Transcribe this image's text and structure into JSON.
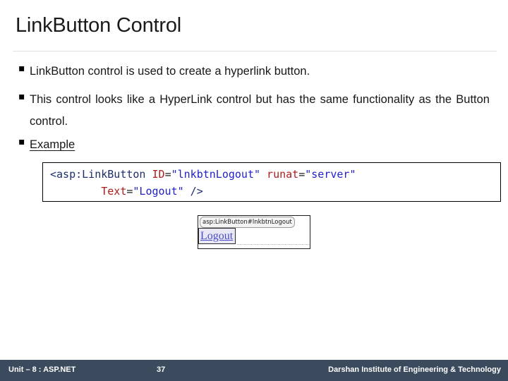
{
  "slide": {
    "title": "LinkButton Control",
    "bullets": [
      {
        "marker": "square",
        "text": "LinkButton control is used to create a hyperlink button."
      },
      {
        "marker": "square",
        "text": "This control looks like a HyperLink control but has the same functionality as the Button control."
      },
      {
        "marker": "square",
        "text": "Example"
      }
    ]
  },
  "code_box": {
    "line1": {
      "tag_open": "<asp:LinkButton",
      "attr1_name": " ID",
      "attr1_eq": "=",
      "attr1_value": "\"lnkbtnLogout\"",
      "attr2_name": " runat",
      "attr2_eq": "=",
      "attr2_value": "\"server\""
    },
    "line2": {
      "indent": "        ",
      "attr3_name": "Text",
      "attr3_eq": "=",
      "attr3_value": "\"Logout\"",
      "tag_close": " />"
    }
  },
  "designer_preview": {
    "tag_label": "asp:LinkButton#lnkbtnLogout",
    "link_text": "Logout"
  },
  "footer": {
    "unit": "Unit – 8 : ASP.NET",
    "page_number": "37",
    "institute": "Darshan Institute of Engineering & Technology"
  },
  "colors": {
    "footer_background": "#3b4a5c",
    "code_tag": "#1c2f6e",
    "code_attribute": "#b01c1c",
    "code_value": "#2222cc",
    "link_color": "#4b4bc8",
    "divider": "#e2e2e2"
  }
}
